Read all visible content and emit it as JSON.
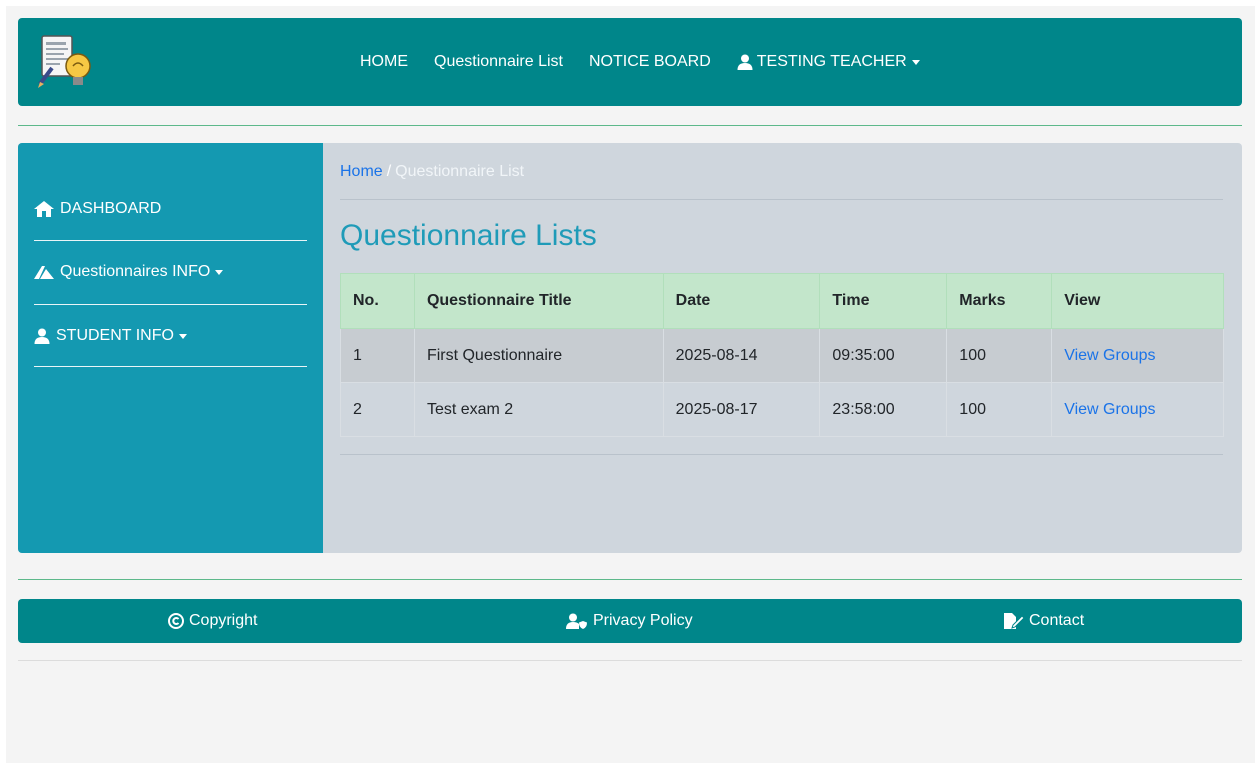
{
  "navbar": {
    "logo_icon": "notes-lightbulb-logo",
    "links": {
      "home": "HOME",
      "questionnaire_list": "Questionnaire List",
      "notice_board": "NOTICE BOARD",
      "user": "TESTING TEACHER"
    },
    "user_icon": "user-icon"
  },
  "sidebar": {
    "dashboard": "DASHBOARD",
    "dashboard_icon": "home-icon",
    "questionnaires": "Questionnaires INFO",
    "questionnaires_icon": "pencil-ruler-icon",
    "student": "STUDENT INFO",
    "student_icon": "user-icon"
  },
  "breadcrumb": {
    "home": "Home",
    "separator": "/",
    "current": "Questionnaire List"
  },
  "main": {
    "title": "Questionnaire Lists"
  },
  "table": {
    "headers": {
      "no": "No.",
      "title": "Questionnaire Title",
      "date": "Date",
      "time": "Time",
      "marks": "Marks",
      "view": "View"
    },
    "rows": [
      {
        "no": "1",
        "title": "First Questionnaire",
        "date": "2025-08-14",
        "time": "09:35:00",
        "marks": "100",
        "view": "View Groups"
      },
      {
        "no": "2",
        "title": "Test exam 2",
        "date": "2025-08-17",
        "time": "23:58:00",
        "marks": "100",
        "view": "View Groups"
      }
    ]
  },
  "footer": {
    "copyright": "Copyright",
    "copyright_icon": "copyright-icon",
    "privacy": "Privacy Policy",
    "privacy_icon": "user-shield-icon",
    "contact": "Contact",
    "contact_icon": "edit-document-icon"
  },
  "colors": {
    "teal": "#00868a",
    "sidebar": "#1499b1",
    "content_bg": "#cfd6dd",
    "table_header": "#c3e6cb",
    "title": "#1f9bb8",
    "link": "#1a73e8"
  }
}
